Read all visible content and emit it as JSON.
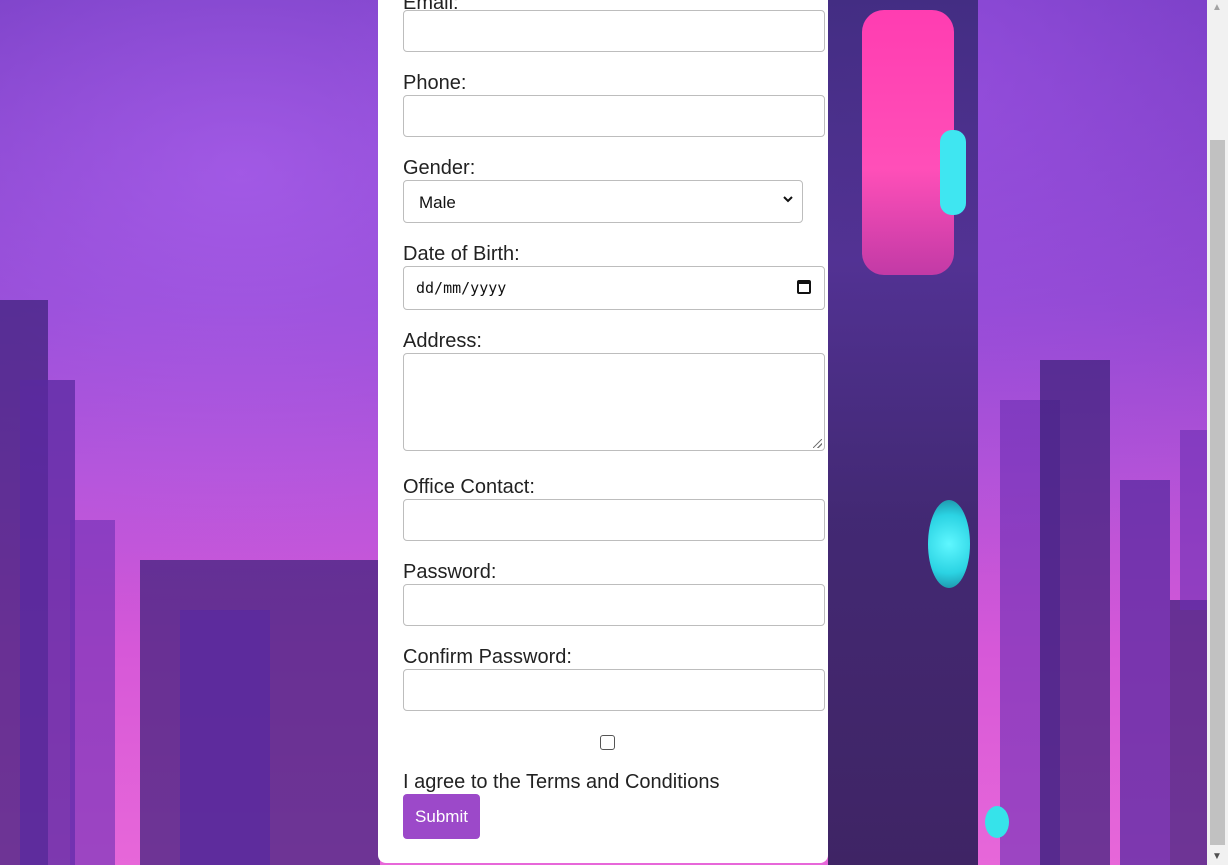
{
  "form": {
    "email_label": "Email:",
    "phone_label": "Phone:",
    "gender_label": "Gender:",
    "gender_selected": "Male",
    "dob_label": "Date of Birth:",
    "dob_placeholder": "dd/mm/yyyy",
    "address_label": "Address:",
    "office_contact_label": "Office Contact:",
    "password_label": "Password:",
    "confirm_password_label": "Confirm Password:",
    "agree_label": "I agree to the Terms and Conditions",
    "submit_label": "Submit",
    "agree_checked": false
  },
  "icons": {
    "select_chevron": "chevron-down-icon",
    "date_picker": "calendar-icon",
    "scroll_up": "scroll-up-arrow-icon",
    "scroll_down": "scroll-down-arrow-icon"
  },
  "colors": {
    "submit_bg": "#9c49c9",
    "background_purple": "#7a3fc0",
    "background_pink": "#e767d9"
  }
}
